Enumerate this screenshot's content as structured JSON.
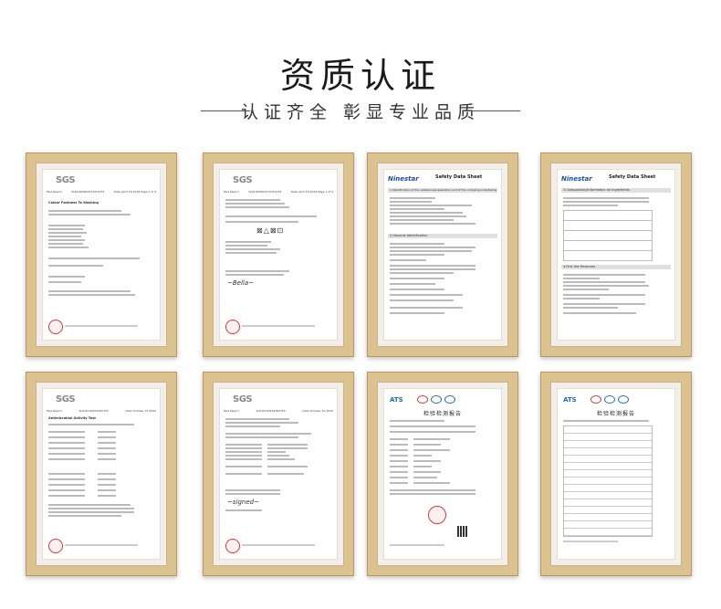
{
  "page": {
    "title": "资质认证",
    "subtitle": "认证齐全 彰显专业品质"
  },
  "certificates": [
    {
      "kind": "sgs",
      "brand": "SGS",
      "head_left": "Test Report",
      "head_mid": "SL6106090247/0072/F4",
      "head_right": "Date April 16,2018   Page 2 of 4",
      "section": "Colour Fastness To Washing"
    },
    {
      "kind": "sgs",
      "brand": "SGS",
      "head_left": "Test Report",
      "head_mid": "SL6106090247/0072/F4",
      "head_right": "Date April 16,2018   Page 1 of 4",
      "section": ""
    },
    {
      "kind": "sds",
      "brand": "Ninestar",
      "doc_title": "Safety Data Sheet",
      "section": "1.Identification of the substance/preparation and of the company/undertaking",
      "section2": "2.Hazards Identification"
    },
    {
      "kind": "sds",
      "brand": "Ninestar",
      "doc_title": "Safety Data Sheet",
      "section": "3.Composition/Information on Ingredients",
      "section2": "4.First Aid Measures"
    },
    {
      "kind": "sgs",
      "brand": "SGS",
      "head_left": "Test Report",
      "head_mid": "SL6101002023601F4",
      "head_right": "Date October 07,2020",
      "section": "Antimicrobial Activity Test"
    },
    {
      "kind": "sgs",
      "brand": "SGS",
      "head_left": "Test Report",
      "head_mid": "SL6101002023601F4",
      "head_right": "Date October 07,2020",
      "section": ""
    },
    {
      "kind": "ats",
      "brand": "ATS",
      "doc_title": "检验检测报告"
    },
    {
      "kind": "ats",
      "brand": "ATS",
      "doc_title": "检验检测报告"
    }
  ]
}
